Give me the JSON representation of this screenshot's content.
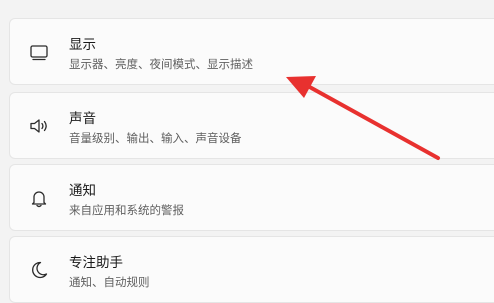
{
  "settings_items": [
    {
      "title": "显示",
      "subtitle": "显示器、亮度、夜间模式、显示描述",
      "icon": "display-icon"
    },
    {
      "title": "声音",
      "subtitle": "音量级别、输出、输入、声音设备",
      "icon": "speaker-icon"
    },
    {
      "title": "通知",
      "subtitle": "来自应用和系统的警报",
      "icon": "bell-icon"
    },
    {
      "title": "专注助手",
      "subtitle": "通知、自动规则",
      "icon": "moon-icon"
    }
  ],
  "colors": {
    "background": "#f3f3f3",
    "card": "#fbfbfb",
    "annotation_arrow": "#e8312f"
  },
  "annotation": {
    "icon": "arrow-pointer",
    "target": "display"
  }
}
